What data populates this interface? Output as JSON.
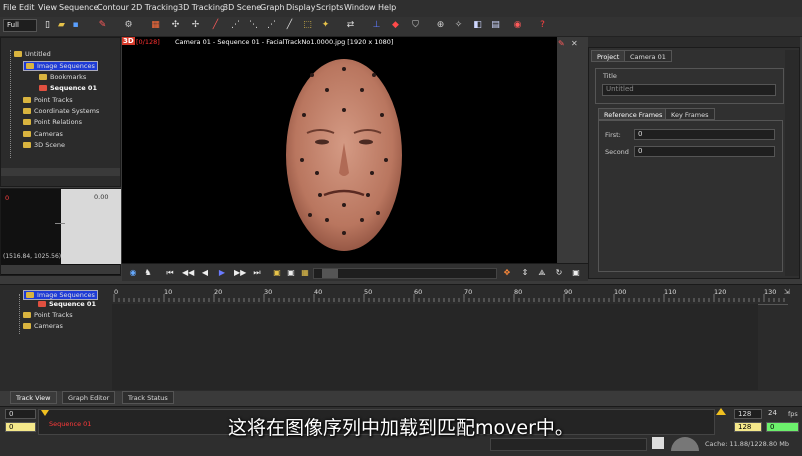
{
  "menu": [
    "File",
    "Edit",
    "View",
    "Sequence",
    "Contour",
    "2D Tracking",
    "3D Tracking",
    "3D Scene",
    "Graph",
    "Display",
    "Scripts",
    "Window",
    "Help"
  ],
  "toolbar": {
    "mode_select": "Full"
  },
  "project_tree": {
    "root": "Untitled",
    "items": [
      "Image Sequences",
      "Bookmarks",
      "Sequence 01",
      "Point Tracks",
      "Coordinate Systems",
      "Point Relations",
      "Cameras",
      "3D Scene"
    ]
  },
  "preview": {
    "left_value": "0",
    "right_value": "0.00",
    "coords": "(1516.84, 1025.56)"
  },
  "viewer": {
    "badge": "3D",
    "frame_info": "[0/128]",
    "title": "Camera 01 - Sequence 01 - FacialTrackNo1.0000.jpg [1920 x 1080]"
  },
  "right_panel": {
    "tabs": [
      "Project",
      "Camera 01"
    ],
    "title_label": "Title",
    "title_value": "Untitled",
    "subtabs": [
      "Reference Frames",
      "Key Frames"
    ],
    "first_label": "First:",
    "first_value": "0",
    "second_label": "Second",
    "second_value": "0"
  },
  "timeline_tree": {
    "items": [
      "Image Sequences",
      "Sequence 01",
      "Point Tracks",
      "Cameras"
    ]
  },
  "timeline_ticks": [
    "0",
    "10",
    "20",
    "30",
    "40",
    "50",
    "60",
    "70",
    "80",
    "90",
    "100",
    "110",
    "120",
    "130"
  ],
  "bottom_tabs": [
    "Track View",
    "Graph Editor",
    "Track Status"
  ],
  "bottom_bar": {
    "start_frame": "0",
    "current_frame": "0",
    "sequence_label": "Sequence 01",
    "end_frame": "128",
    "fps_value": "24",
    "fps_label": "fps",
    "end_frame2": "128",
    "current2": "0",
    "cache": "Cache: 11.88/1228.80 Mb"
  },
  "subtitle": "这将在图像序列中加载到匹配mover中。",
  "colors": {
    "accent_blue": "#1e3bd6",
    "folder": "#d9b43f",
    "play_blue": "#6a7bff",
    "status_green": "#6cf06c"
  }
}
